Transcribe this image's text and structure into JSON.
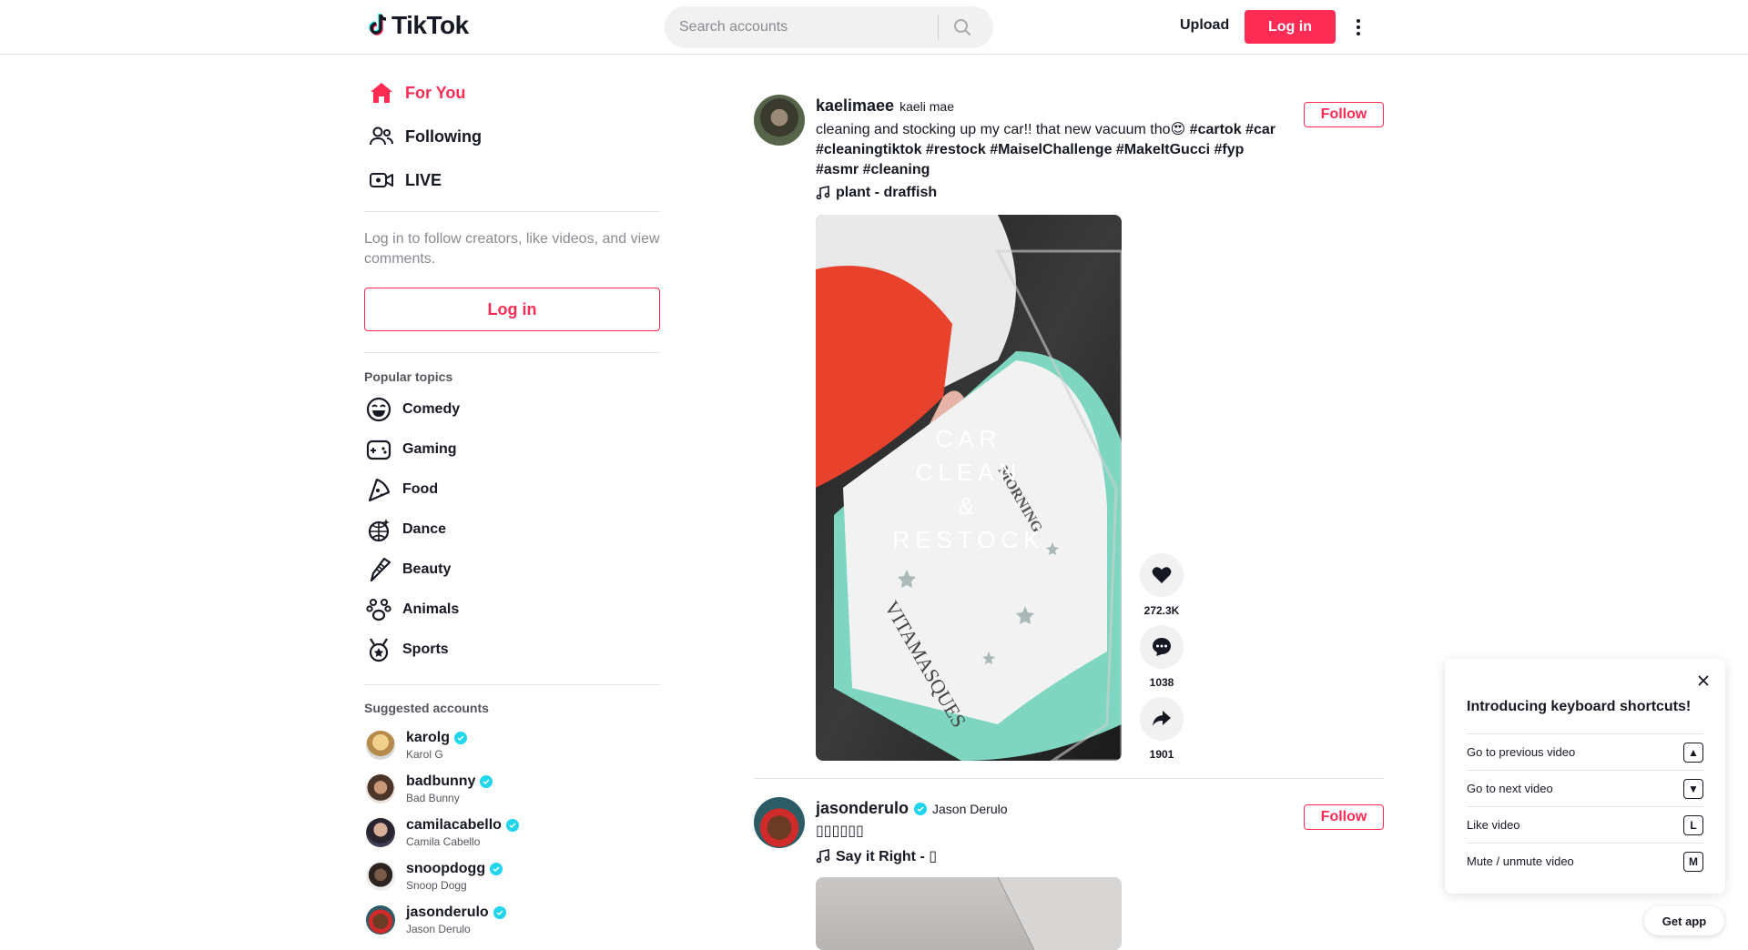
{
  "header": {
    "brand": "TikTok",
    "search_placeholder": "Search accounts",
    "upload_label": "Upload",
    "login_label": "Log in"
  },
  "sidebar": {
    "nav": [
      {
        "label": "For You",
        "icon": "home-icon",
        "active": true
      },
      {
        "label": "Following",
        "icon": "following-icon"
      },
      {
        "label": "LIVE",
        "icon": "live-icon"
      }
    ],
    "login_note": "Log in to follow creators, like videos, and view comments.",
    "login_button": "Log in",
    "popular_title": "Popular topics",
    "topics": [
      {
        "label": "Comedy",
        "icon": "comedy-icon"
      },
      {
        "label": "Gaming",
        "icon": "gaming-icon"
      },
      {
        "label": "Food",
        "icon": "food-icon"
      },
      {
        "label": "Dance",
        "icon": "dance-icon"
      },
      {
        "label": "Beauty",
        "icon": "beauty-icon"
      },
      {
        "label": "Animals",
        "icon": "animals-icon"
      },
      {
        "label": "Sports",
        "icon": "sports-icon"
      }
    ],
    "suggested_title": "Suggested accounts",
    "accounts": [
      {
        "username": "karolg",
        "name": "Karol G",
        "verified": true
      },
      {
        "username": "badbunny",
        "name": "Bad Bunny",
        "verified": true
      },
      {
        "username": "camilacabello",
        "name": "Camila Cabello",
        "verified": true
      },
      {
        "username": "snoopdogg",
        "name": "Snoop Dogg",
        "verified": true
      },
      {
        "username": "jasonderulo",
        "name": "Jason Derulo",
        "verified": true
      }
    ]
  },
  "feed": {
    "posts": [
      {
        "username": "kaelimaee",
        "nickname": "kaeli mae",
        "caption_text": "cleaning and stocking up my car!! that new vacuum tho😍",
        "caption_tags": " #cartok #car #cleaningtiktok #restock #MaiselChallenge #MakeItGucci #fyp #asmr #cleaning",
        "music": "plant - draffish",
        "follow_label": "Follow",
        "video_overlay": [
          "CAR",
          "CLEAN",
          "&",
          "RESTOCK"
        ],
        "likes": "272.3K",
        "comments": "1038",
        "shares": "1901"
      },
      {
        "username": "jasonderulo",
        "nickname": "Jason Derulo",
        "caption_text": "▯▯▯▯▯▯",
        "music": "Say it Right - ▯",
        "follow_label": "Follow"
      }
    ]
  },
  "shortcuts": {
    "title": "Introducing keyboard shortcuts!",
    "rows": [
      {
        "label": "Go to previous video",
        "key": "▲"
      },
      {
        "label": "Go to next video",
        "key": "▼"
      },
      {
        "label": "Like video",
        "key": "L"
      },
      {
        "label": "Mute / unmute video",
        "key": "M"
      }
    ]
  },
  "get_app": "Get app",
  "colors": {
    "accent": "#fe2c55",
    "verified": "#20d5ec",
    "text": "#161823",
    "muted": "#8a8b91"
  }
}
